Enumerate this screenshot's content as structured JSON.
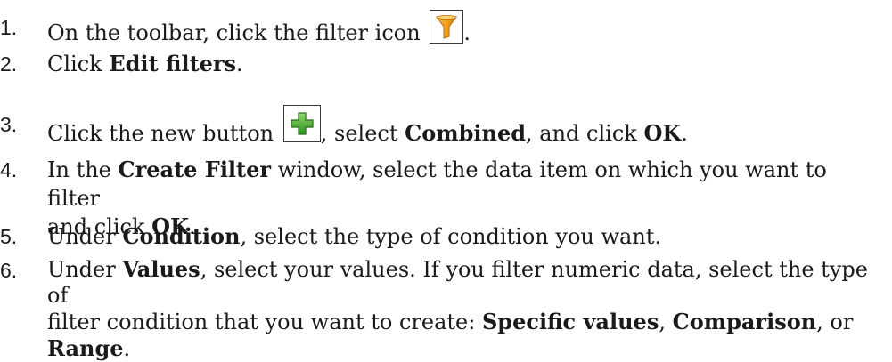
{
  "steps": [
    {
      "num": "1.",
      "t1": "On the toolbar, click the filter icon",
      "t2": "."
    },
    {
      "num": "2.",
      "t1": "Click ",
      "b1": "Edit filters",
      "t2": "."
    },
    {
      "num": "3.",
      "t1": "Click the new button",
      "t2": ", select ",
      "b1": "Combined",
      "t3": ", and click ",
      "b2": "OK",
      "t4": "."
    },
    {
      "num": "4.",
      "t1": "In the ",
      "b1": "Create Filter",
      "t2": " window, select the data item on which you want to filter",
      "line2a": "and click ",
      "b2": "OK",
      "line2b": "."
    },
    {
      "num": "5.",
      "t1": "Under ",
      "b1": "Condition",
      "t2": ", select the type of condition you want."
    },
    {
      "num": "6.",
      "t1": "Under ",
      "b1": "Values",
      "t2": ", select your values. If you filter numeric data, select the type of",
      "line2a": "filter condition that you want to create: ",
      "b2": "Specific values",
      "line2b": ", ",
      "b3": "Comparison",
      "line2c": ", or",
      "b4": "Range",
      "line3b": "."
    }
  ],
  "icons": {
    "filter": "funnel-filter-icon",
    "new": "green-plus-icon",
    "filter_color": "#f3a01a",
    "new_color": "#3aa12a"
  }
}
